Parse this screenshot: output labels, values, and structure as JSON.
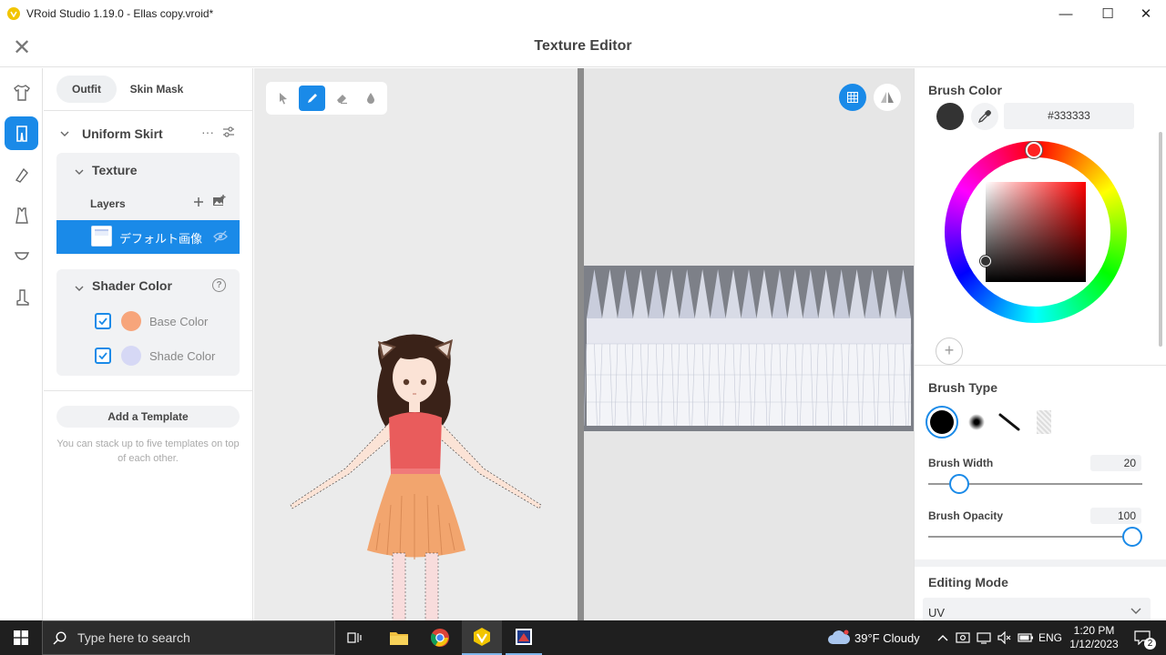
{
  "window": {
    "title": "VRoid Studio 1.19.0 - Ellas copy.vroid*",
    "minimize": "—",
    "maximize": "☐",
    "close": "✕"
  },
  "header": {
    "close_glyph": "✕",
    "title": "Texture Editor"
  },
  "rail": {
    "items": [
      "shirt-icon",
      "skirt-icon",
      "accessory-icon",
      "onepiece-icon",
      "underwear-icon",
      "shoe-icon"
    ],
    "active_index": 1
  },
  "left_panel": {
    "tabs": [
      {
        "label": "Outfit",
        "active": true
      },
      {
        "label": "Skin Mask",
        "active": false
      }
    ],
    "item": {
      "name": "Uniform Skirt",
      "more": "···"
    },
    "texture": {
      "title": "Texture",
      "layers_label": "Layers",
      "layers": [
        {
          "name": "デフォルト画像",
          "selected": true,
          "hidden": true
        }
      ]
    },
    "shader": {
      "title": "Shader Color",
      "help": "?",
      "colors": [
        {
          "label": "Base Color",
          "color": "#f7a57b",
          "checked": true
        },
        {
          "label": "Shade Color",
          "color": "#d6d8f5",
          "checked": true
        }
      ]
    },
    "template": {
      "button": "Add a Template",
      "hint": "You can stack up to five templates on top of each other."
    }
  },
  "tools": {
    "items": [
      "select-icon",
      "pencil-icon",
      "eraser-icon",
      "fill-icon"
    ],
    "active_index": 1
  },
  "right_panel": {
    "brush_color": {
      "title": "Brush Color",
      "hex": "#333333",
      "color": "#333333",
      "add": "+"
    },
    "brush_type": {
      "title": "Brush Type",
      "selected_index": 0
    },
    "brush_width": {
      "label": "Brush Width",
      "value": "20",
      "fraction": 0.11
    },
    "brush_opacity": {
      "label": "Brush Opacity",
      "value": "100",
      "fraction": 1.0
    },
    "editing_mode": {
      "title": "Editing Mode",
      "value": "UV"
    }
  },
  "taskbar": {
    "search_placeholder": "Type here to search",
    "weather": "39°F  Cloudy",
    "lang": "ENG",
    "time": "1:20 PM",
    "date": "1/12/2023",
    "notifications": "2"
  },
  "colors": {
    "accent": "#1a8ae8",
    "taskbar": "#1f1f1f"
  }
}
